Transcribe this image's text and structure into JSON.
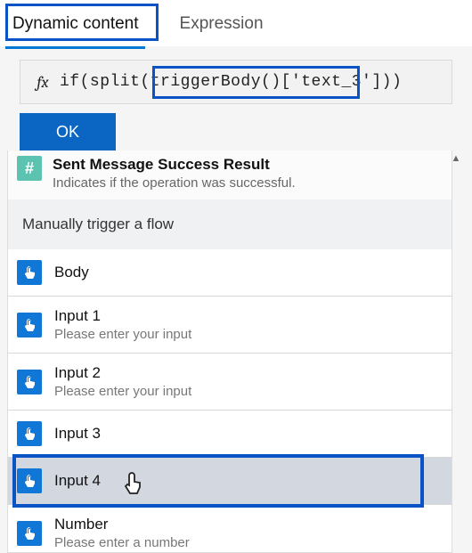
{
  "tabs": {
    "dynamic": "Dynamic content",
    "expression": "Expression"
  },
  "expression": {
    "fx": "fx",
    "text": "if(split(triggerBody()['text_3']))"
  },
  "ok_label": "OK",
  "sent": {
    "title": "Sent Message Success Result",
    "subtitle": "Indicates if the operation was successful."
  },
  "section_header": "Manually trigger a flow",
  "items": [
    {
      "title": "Body",
      "sub": ""
    },
    {
      "title": "Input 1",
      "sub": "Please enter your input"
    },
    {
      "title": "Input 2",
      "sub": "Please enter your input"
    },
    {
      "title": "Input 3",
      "sub": ""
    },
    {
      "title": "Input 4",
      "sub": ""
    },
    {
      "title": "Number",
      "sub": "Please enter a number"
    }
  ]
}
